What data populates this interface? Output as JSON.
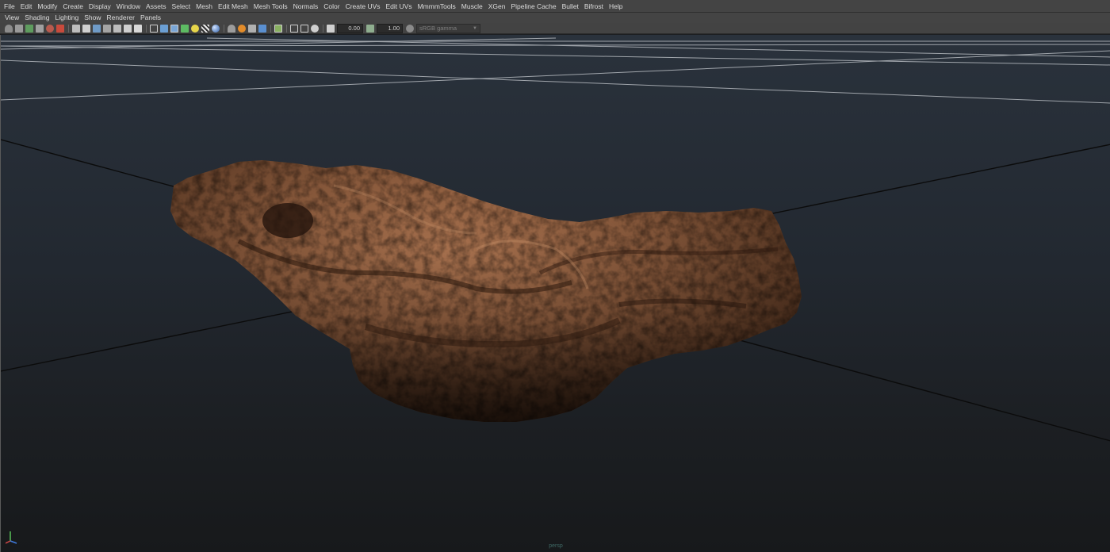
{
  "menubar": {
    "items": [
      "File",
      "Edit",
      "Modify",
      "Create",
      "Display",
      "Window",
      "Assets",
      "Select",
      "Mesh",
      "Edit Mesh",
      "Mesh Tools",
      "Normals",
      "Color",
      "Create UVs",
      "Edit UVs",
      "MmmmTools",
      "Muscle",
      "XGen",
      "Pipeline Cache",
      "Bullet",
      "Bifrost",
      "Help"
    ]
  },
  "panel_menu": {
    "items": [
      "View",
      "Shading",
      "Lighting",
      "Show",
      "Renderer",
      "Panels"
    ]
  },
  "toolbar": {
    "exposure_value": "0.00",
    "gamma_value": "1.00",
    "color_space": "sRGB gamma"
  },
  "viewport": {
    "camera_label": "persp",
    "colors": {
      "rock_light": "#b57a54",
      "rock_mid": "#8a5a3c",
      "rock_dark": "#3e2516",
      "grid": "#c9cdd2",
      "axis": "#0b0b0b"
    }
  }
}
